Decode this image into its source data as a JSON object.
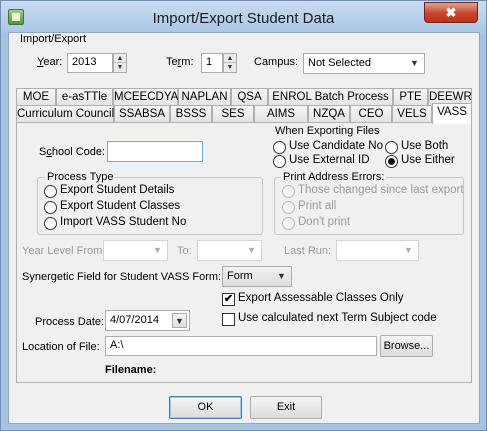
{
  "window": {
    "title": "Import/Export Student Data",
    "close_symbol": "✖"
  },
  "import_export": {
    "legend": "Import/Export",
    "year_label_u": "Y",
    "year_label_rest": "ear:",
    "year_value": "2013",
    "term_label_pre": "Te",
    "term_label_u": "r",
    "term_label_rest": "m:",
    "term_value": "1",
    "campus_label": "Campus:",
    "campus_value": "Not Selected"
  },
  "tabs_row1": [
    "MOE",
    "e-asTTle",
    "MCEECDYA",
    "NAPLAN",
    "QSA",
    "ENROL Batch Process",
    "PTE",
    "DEEWR"
  ],
  "tabs_row2": [
    "Curriculum Council",
    "SSABSA",
    "BSSS",
    "SES",
    "AIMS",
    "NZQA",
    "CEO",
    "VELS",
    "VASS"
  ],
  "active_tab": "VASS",
  "vass": {
    "school_code_label_pre": "S",
    "school_code_label_u": "c",
    "school_code_label_rest": "hool Code:",
    "school_code_value": "",
    "when_exporting": {
      "legend": "When Exporting Files",
      "options": [
        "Use Candidate No",
        "Use Both",
        "Use External ID",
        "Use Either"
      ],
      "selected": "Use Either"
    },
    "process_type": {
      "legend": "Process Type",
      "options": [
        "Export Student Details",
        "Export Student Classes",
        "Import VASS Student No"
      ]
    },
    "print_address_errors": {
      "legend": "Print Address Errors:",
      "options": [
        "Those changed since last export",
        "Print all",
        "Don't print"
      ]
    },
    "year_level_from_label": "Year Level From:",
    "to_label": "To:",
    "last_run_label": "Last Run:",
    "synergetic_field_label": "Synergetic Field for Student VASS Form:",
    "synergetic_field_value": "Form",
    "export_assessable_label": "Export Assessable Classes Only",
    "export_assessable_checked": true,
    "use_calculated_label": "Use calculated next Term Subject code",
    "use_calculated_checked": false,
    "process_date_label": "Process Date:",
    "process_date_value": "4/07/2014",
    "location_label": "Location of File:",
    "location_value": "A:\\",
    "browse_label": "Browse...",
    "filename_label": "Filename:"
  },
  "buttons": {
    "ok": "OK",
    "exit": "Exit"
  },
  "icons": {
    "spin_up": "▲",
    "spin_down": "▼",
    "dropdown": "▼",
    "check": "✔"
  }
}
